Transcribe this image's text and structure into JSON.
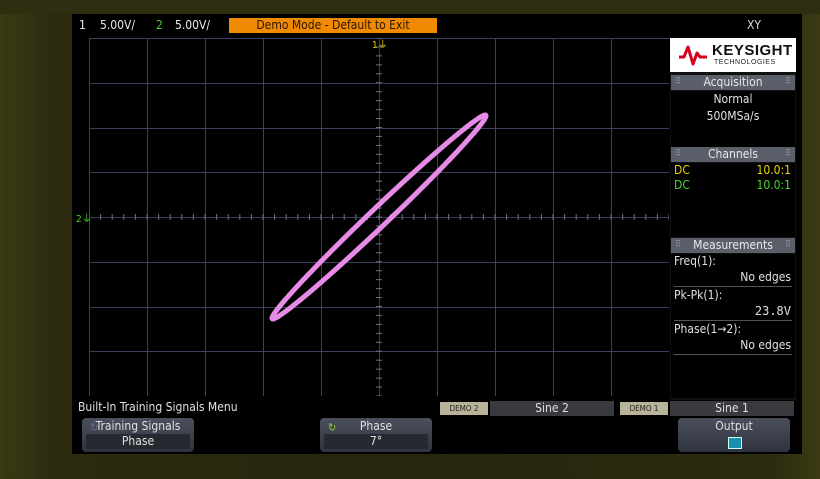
{
  "status_bar": {
    "ch1_number": "1",
    "ch1_scale": "5.00V/",
    "ch2_number": "2",
    "ch2_scale": "5.00V/",
    "demo_banner": "Demo Mode - Default to Exit",
    "mode": "XY"
  },
  "markers": {
    "ch1_marker": "1",
    "ch2_marker": "2"
  },
  "brand": {
    "name": "KEYSIGHT",
    "sub": "TECHNOLOGIES"
  },
  "acquisition": {
    "title": "Acquisition",
    "mode": "Normal",
    "rate": "500MSa/s"
  },
  "channels": {
    "title": "Channels",
    "rows": [
      {
        "coupling": "DC",
        "probe": "10.0:1",
        "color": "#e8d400"
      },
      {
        "coupling": "DC",
        "probe": "10.0:1",
        "color": "#4ad42a"
      }
    ]
  },
  "measurements": {
    "title": "Measurements",
    "items": [
      {
        "label": "Freq(1):",
        "value": "No edges"
      },
      {
        "label": "Pk-Pk(1):",
        "value": "23.8V"
      },
      {
        "label": "Phase(1→2):",
        "value": "No edges"
      }
    ]
  },
  "bottom": {
    "menu_title": "Built-In Training Signals Menu",
    "demo2_tag": "DEMO 2",
    "demo2_value": "Sine 2",
    "demo1_tag": "DEMO 1",
    "demo1_value": "Sine 1"
  },
  "softkeys": {
    "training_top": "Training Signals",
    "training_bottom": "Phase",
    "phase_top": "Phase",
    "phase_bottom": "7°",
    "output_top": "Output"
  },
  "colors": {
    "trace": "#e68ce6",
    "ch1": "#e8d400",
    "ch2": "#4ad42a",
    "banner": "#f08a00"
  },
  "trace": {
    "phase_deg": 7
  }
}
